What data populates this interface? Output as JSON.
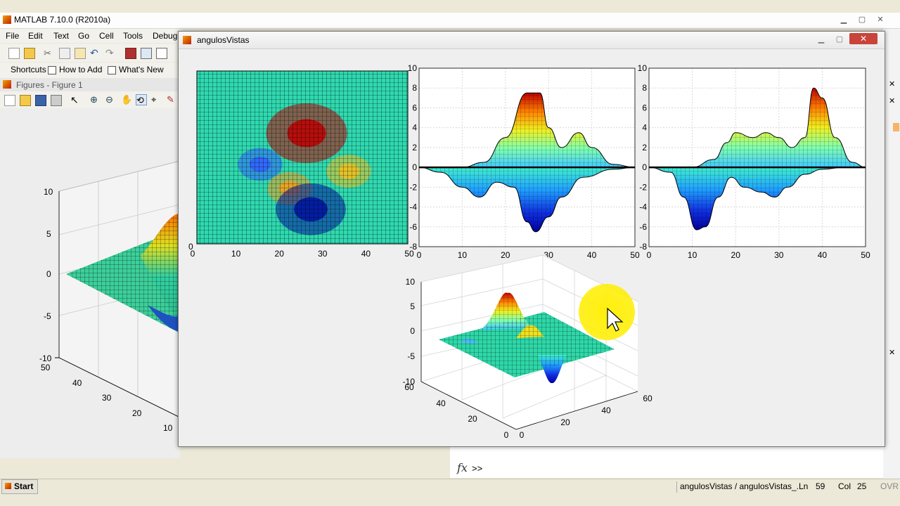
{
  "main_window": {
    "title": "MATLAB  7.10.0 (R2010a)",
    "menu": [
      "File",
      "Edit",
      "Text",
      "Go",
      "Cell",
      "Tools",
      "Debug"
    ],
    "shortcuts": [
      "Shortcuts",
      "How to Add",
      "What's New"
    ],
    "figures_label": "Figures - Figure 1",
    "command_prompt": ">>",
    "fx_label": "fx",
    "start": "Start",
    "status": {
      "file": "angulosVistas / angulosVistas_...",
      "ln_label": "Ln",
      "ln": "59",
      "col_label": "Col",
      "col": "25",
      "mode": "OVR"
    }
  },
  "figure_window": {
    "title": "angulosVistas"
  },
  "background_figure": {
    "z_ticks": [
      "10",
      "5",
      "0",
      "-5",
      "-10"
    ],
    "y_ticks": [
      "50",
      "40",
      "30",
      "20",
      "10"
    ]
  },
  "chart_data": [
    {
      "type": "heatmap",
      "title": "",
      "xlim": [
        0,
        50
      ],
      "x_ticks": [
        "0",
        "10",
        "20",
        "30",
        "40",
        "50"
      ],
      "y_ticks": [
        "0"
      ],
      "peaks": [
        {
          "x": 26,
          "y": 32,
          "value": 8,
          "color": "#c00000"
        },
        {
          "x": 15,
          "y": 23,
          "value": -3,
          "color": "#3060ff"
        },
        {
          "x": 36,
          "y": 21,
          "value": 3,
          "color": "#f0c020"
        },
        {
          "x": 22,
          "y": 16,
          "value": 3,
          "color": "#f0a020"
        },
        {
          "x": 27,
          "y": 10,
          "value": -6.5,
          "color": "#0010a0"
        }
      ]
    },
    {
      "type": "area",
      "title": "",
      "xlim": [
        0,
        50
      ],
      "ylim": [
        -8,
        10
      ],
      "x_ticks": [
        "0",
        "10",
        "20",
        "30",
        "40",
        "50"
      ],
      "y_ticks": [
        "10",
        "8",
        "6",
        "4",
        "2",
        "0",
        "-2",
        "-4",
        "-6",
        "-8"
      ],
      "upper_profile": {
        "x": [
          0,
          10,
          15,
          20,
          25,
          28,
          30,
          33,
          37,
          40,
          45,
          50
        ],
        "y": [
          0,
          0,
          0.5,
          3,
          7.5,
          7.5,
          4,
          2,
          3.5,
          2,
          0.3,
          0
        ]
      },
      "lower_profile": {
        "x": [
          0,
          5,
          10,
          14,
          18,
          22,
          25,
          27,
          30,
          33,
          38,
          45,
          50
        ],
        "y": [
          0,
          -0.5,
          -2,
          -3,
          -1.5,
          -2,
          -5.5,
          -6.5,
          -5,
          -3,
          -1,
          -0.2,
          0
        ]
      },
      "grid": true
    },
    {
      "type": "area",
      "title": "",
      "xlim": [
        0,
        50
      ],
      "ylim": [
        -8,
        10
      ],
      "x_ticks": [
        "0",
        "10",
        "20",
        "30",
        "40",
        "50"
      ],
      "y_ticks": [
        "10",
        "8",
        "6",
        "4",
        "2",
        "0",
        "-2",
        "-4",
        "-6",
        "-8"
      ],
      "upper_profile": {
        "x": [
          0,
          10,
          15,
          18,
          20,
          24,
          27,
          30,
          33,
          36,
          38,
          40,
          43,
          47,
          50
        ],
        "y": [
          0,
          0,
          0.8,
          2.5,
          3.5,
          3,
          3.5,
          3,
          2,
          3,
          8,
          7,
          3,
          0.5,
          0
        ]
      },
      "lower_profile": {
        "x": [
          0,
          5,
          8,
          11,
          13,
          16,
          19,
          22,
          26,
          29,
          32,
          36,
          40,
          45,
          50
        ],
        "y": [
          0,
          -0.5,
          -3,
          -6.3,
          -6,
          -3,
          -1,
          -2,
          -2.5,
          -3,
          -2,
          -0.7,
          -0.2,
          0,
          0
        ]
      },
      "grid": true
    },
    {
      "type": "surface",
      "title": "",
      "z_ticks": [
        "10",
        "5",
        "0",
        "-5",
        "-10"
      ],
      "left_ticks": [
        "60",
        "40",
        "20",
        "0"
      ],
      "right_ticks": [
        "0",
        "20",
        "40",
        "60"
      ],
      "grid": true
    }
  ],
  "colors": {
    "cursor_highlight": "#ffee00",
    "jet_low": "#00008f",
    "jet_high": "#800000"
  }
}
